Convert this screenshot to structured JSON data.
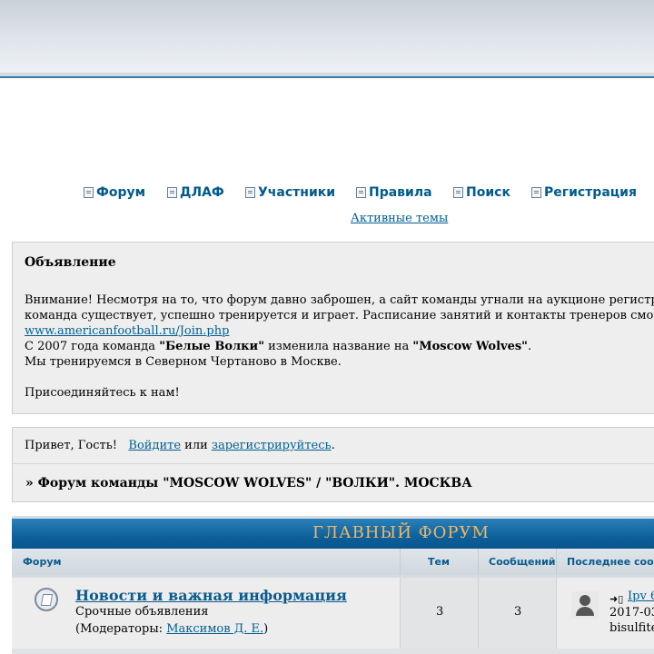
{
  "nav": {
    "items": [
      {
        "label": "Форум",
        "icon": "forum-icon"
      },
      {
        "label": "ДЛАФ",
        "icon": "image-icon"
      },
      {
        "label": "Участники",
        "icon": "members-icon"
      },
      {
        "label": "Правила",
        "icon": "rules-icon"
      },
      {
        "label": "Поиск",
        "icon": "search-icon"
      },
      {
        "label": "Регистрация",
        "icon": "register-icon"
      }
    ],
    "active_topics": "Активные темы"
  },
  "announcement": {
    "title": "Объявление",
    "line1": "Внимание! Несмотря на то, что форум давно заброшен, а сайт команды угнали на аукционе регистр",
    "line2": "команда существует, успешно тренируется и играет. Расписание занятий и контакты тренеров смот",
    "link": "www.americanfootball.ru/Join.php",
    "line4_a": "С 2007 года команда ",
    "line4_b": "\"Белые Волки\"",
    "line4_c": " изменила название на ",
    "line4_d": "\"Moscow Wolves\"",
    "line4_e": ".",
    "line5": "Мы тренируемся в Северном Чертаново в Москве.",
    "line6": "Присоединяйтесь к нам!"
  },
  "greeting": {
    "hello": "Привет, Гость!",
    "login": "Войдите",
    "or": " или ",
    "register": "зарегистрируйтесь",
    "dot": "."
  },
  "breadcrumb": "» Форум команды \"MOSCOW WOLVES\" / \"ВОЛКИ\". МОСКВА",
  "section": {
    "title": "ГЛАВНЫЙ ФОРУМ",
    "columns": {
      "forum": "Форум",
      "topics": "Тем",
      "posts": "Сообщений",
      "last_post": "Последнее сооб"
    }
  },
  "forums": [
    {
      "name": "Новости и важная информация",
      "description": "Срочные объявления",
      "mods_prefix": "(Модераторы: ",
      "mods_name": "Максимов Д. Е.",
      "mods_suffix": ")",
      "topics": "3",
      "posts": "3",
      "last_link": "Ipv 6",
      "last_date": "2017-03",
      "last_user": "bisulfite"
    }
  ],
  "colors": {
    "link": "#005f92",
    "header_bar": "#0b5f99",
    "header_title": "#f0b56a"
  }
}
